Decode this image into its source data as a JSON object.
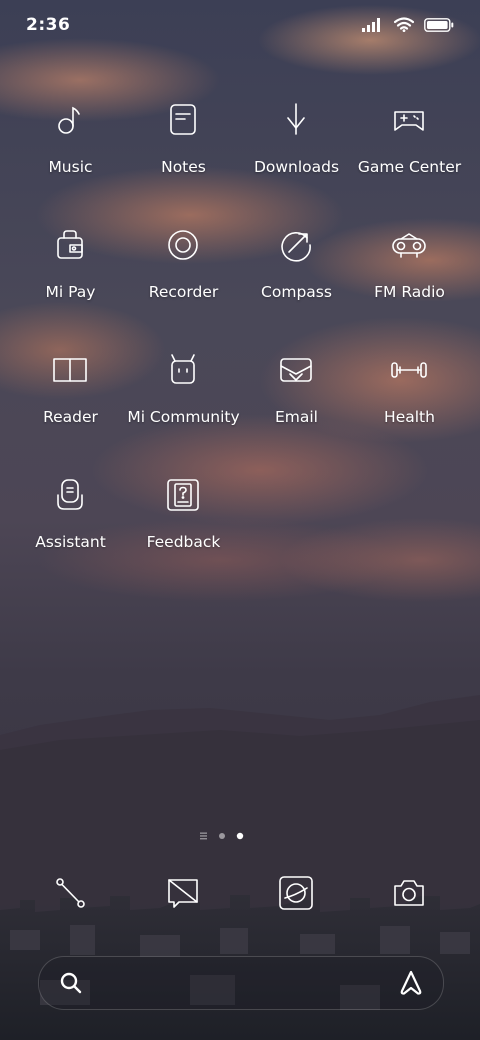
{
  "status": {
    "time": "2:36",
    "icons": [
      "signal-icon",
      "wifi-icon",
      "battery-icon"
    ]
  },
  "apps": [
    {
      "label": "Music",
      "icon": "music-note-icon"
    },
    {
      "label": "Notes",
      "icon": "notes-icon"
    },
    {
      "label": "Downloads",
      "icon": "download-arrow-icon"
    },
    {
      "label": "Game Center",
      "icon": "gamepad-icon"
    },
    {
      "label": "Mi Pay",
      "icon": "wallet-icon"
    },
    {
      "label": "Recorder",
      "icon": "record-circle-icon"
    },
    {
      "label": "Compass",
      "icon": "compass-icon"
    },
    {
      "label": "FM Radio",
      "icon": "radio-icon"
    },
    {
      "label": "Reader",
      "icon": "open-book-icon"
    },
    {
      "label": "Mi Community",
      "icon": "mi-bunny-icon"
    },
    {
      "label": "Email",
      "icon": "envelope-icon"
    },
    {
      "label": "Health",
      "icon": "dumbbell-icon"
    },
    {
      "label": "Assistant",
      "icon": "assistant-icon"
    },
    {
      "label": "Feedback",
      "icon": "feedback-icon"
    }
  ],
  "page_indicator": {
    "pages": 3,
    "current": 3
  },
  "dock": [
    {
      "icon": "phone-icon"
    },
    {
      "icon": "message-icon"
    },
    {
      "icon": "browser-icon"
    },
    {
      "icon": "camera-icon"
    }
  ],
  "search_bar": {
    "left_icon": "search-icon",
    "right_icon": "app-vault-icon"
  },
  "colors": {
    "icon_stroke": "#ffffff",
    "sky_glow": "#e39a72"
  }
}
